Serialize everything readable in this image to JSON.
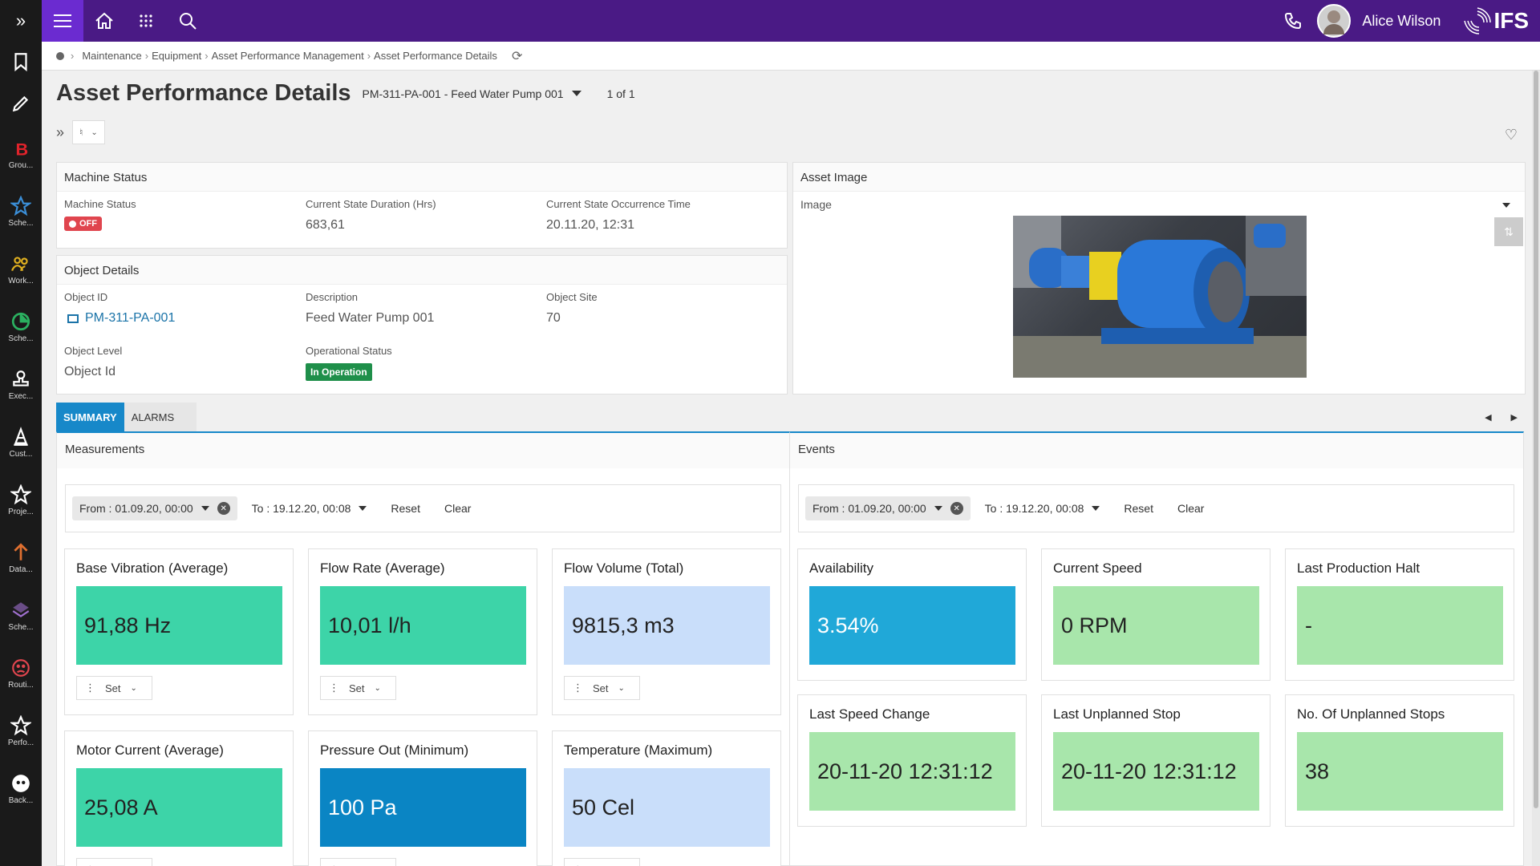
{
  "nav_rail": {
    "expand_icon": "double-chevron-right",
    "items": [
      {
        "label": "",
        "icon": "bookmark"
      },
      {
        "label": "",
        "icon": "pencil"
      },
      {
        "label": "Grou...",
        "icon": "b-letter",
        "color": "#e0232b"
      },
      {
        "label": "Sche...",
        "icon": "star",
        "color": "#3b8fd8"
      },
      {
        "label": "Work...",
        "icon": "people",
        "color": "#e0b020"
      },
      {
        "label": "Sche...",
        "icon": "pie",
        "color": "#2bb060"
      },
      {
        "label": "Exec...",
        "icon": "stamp",
        "color": "#ffffff"
      },
      {
        "label": "Cust...",
        "icon": "cone",
        "color": "#ffffff"
      },
      {
        "label": "Proje...",
        "icon": "star-outline",
        "color": "#ffffff"
      },
      {
        "label": "Data...",
        "icon": "arrow-up",
        "color": "#e07030"
      },
      {
        "label": "Sche...",
        "icon": "layers",
        "color": "#a070d0"
      },
      {
        "label": "Routi...",
        "icon": "sad-face",
        "color": "#e0454e"
      },
      {
        "label": "Perfo...",
        "icon": "star-outline",
        "color": "#ffffff"
      },
      {
        "label": "Back...",
        "icon": "face",
        "color": "#ffffff"
      }
    ]
  },
  "topbar": {
    "bg": "#4a1a85",
    "user_name": "Alice Wilson",
    "logo_text": "IFS"
  },
  "breadcrumb": [
    "Maintenance",
    "Equipment",
    "Asset Performance Management",
    "Asset Performance Details"
  ],
  "page": {
    "title": "Asset Performance Details",
    "record": "PM-311-PA-001 - Feed Water Pump 001",
    "pager": "1 of 1"
  },
  "machine_status": {
    "title": "Machine Status",
    "status_label": "Machine Status",
    "status_value": "OFF",
    "duration_label": "Current State Duration (Hrs)",
    "duration_value": "683,61",
    "occurrence_label": "Current State Occurrence Time",
    "occurrence_value": "20.11.20, 12:31"
  },
  "object_details": {
    "title": "Object Details",
    "object_id_label": "Object ID",
    "object_id_value": "PM-311-PA-001",
    "description_label": "Description",
    "description_value": "Feed Water Pump 001",
    "site_label": "Object Site",
    "site_value": "70",
    "level_label": "Object Level",
    "level_value": "Object Id",
    "op_status_label": "Operational Status",
    "op_status_value": "In Operation"
  },
  "asset_image": {
    "title": "Asset Image",
    "image_label": "Image"
  },
  "tabs": [
    {
      "label": "SUMMARY",
      "active": true
    },
    {
      "label": "ALARMS",
      "active": false
    }
  ],
  "measurements": {
    "title": "Measurements",
    "from": "From : 01.09.20, 00:00",
    "to": "To : 19.12.20, 00:08",
    "reset": "Reset",
    "clear": "Clear",
    "set_label": "Set",
    "tiles": [
      {
        "title": "Base Vibration (Average)",
        "value": "91,88 Hz",
        "color": "#3dd4a8"
      },
      {
        "title": "Flow Rate (Average)",
        "value": "10,01 l/h",
        "color": "#3dd4a8"
      },
      {
        "title": "Flow Volume (Total)",
        "value": "9815,3 m3",
        "color": "#c9defa"
      },
      {
        "title": "Motor Current (Average)",
        "value": "25,08 A",
        "color": "#3dd4a8"
      },
      {
        "title": "Pressure Out (Minimum)",
        "value": "100 Pa",
        "color": "#0a85c4"
      },
      {
        "title": "Temperature (Maximum)",
        "value": "50 Cel",
        "color": "#c9defa"
      }
    ]
  },
  "events": {
    "title": "Events",
    "from": "From : 01.09.20, 00:00",
    "to": "To : 19.12.20, 00:08",
    "reset": "Reset",
    "clear": "Clear",
    "tiles": [
      {
        "title": "Availability",
        "value": "3.54%",
        "color": "#20a8d8"
      },
      {
        "title": "Current Speed",
        "value": "0 RPM",
        "color": "#a8e6ab"
      },
      {
        "title": "Last Production Halt",
        "value": "-",
        "color": "#a8e6ab"
      },
      {
        "title": "Last Speed Change",
        "value": "20-11-20 12:31:12",
        "color": "#a8e6ab"
      },
      {
        "title": "Last Unplanned Stop",
        "value": "20-11-20 12:31:12",
        "color": "#a8e6ab"
      },
      {
        "title": "No. Of Unplanned Stops",
        "value": "38",
        "color": "#a8e6ab"
      }
    ]
  }
}
